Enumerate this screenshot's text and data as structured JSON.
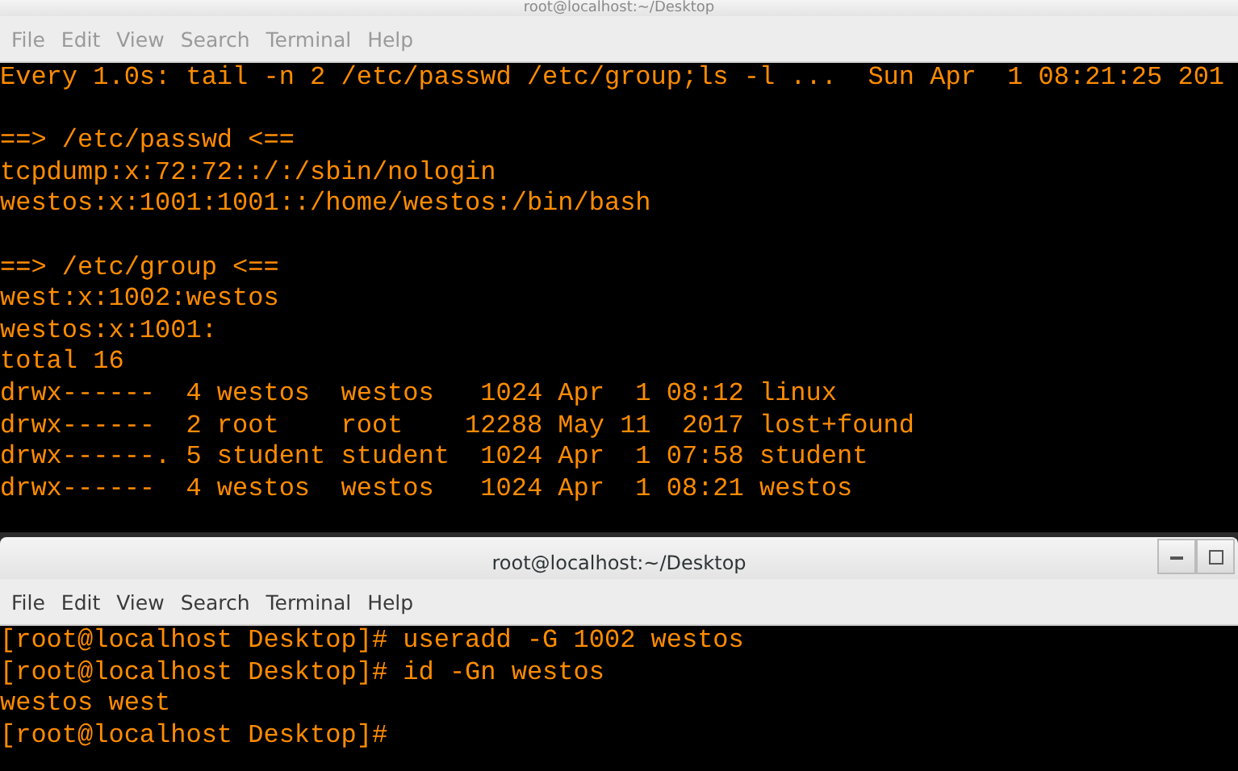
{
  "windows": [
    {
      "title": "root@localhost:~/Desktop",
      "active": false,
      "menu": [
        "File",
        "Edit",
        "View",
        "Search",
        "Terminal",
        "Help"
      ],
      "blocks": [
        [
          "Every 1.0s: tail -n 2 /etc/passwd /etc/group;ls -l ...  Sun Apr  1 08:21:25 201"
        ],
        [
          "==> /etc/passwd <==",
          "tcpdump:x:72:72::/:/sbin/nologin",
          "westos:x:1001:1001::/home/westos:/bin/bash"
        ],
        [
          "==> /etc/group <==",
          "west:x:1002:westos",
          "westos:x:1001:",
          "total 16",
          "drwx------  4 westos  westos   1024 Apr  1 08:12 linux",
          "drwx------  2 root    root    12288 May 11  2017 lost+found",
          "drwx------. 5 student student  1024 Apr  1 07:58 student",
          "drwx------  4 westos  westos   1024 Apr  1 08:21 westos"
        ]
      ]
    },
    {
      "title": "root@localhost:~/Desktop",
      "active": true,
      "menu": [
        "File",
        "Edit",
        "View",
        "Search",
        "Terminal",
        "Help"
      ],
      "blocks": [
        [
          "[root@localhost Desktop]# useradd -G 1002 westos",
          "[root@localhost Desktop]# id -Gn westos",
          "westos west",
          "[root@localhost Desktop]#"
        ]
      ]
    }
  ]
}
